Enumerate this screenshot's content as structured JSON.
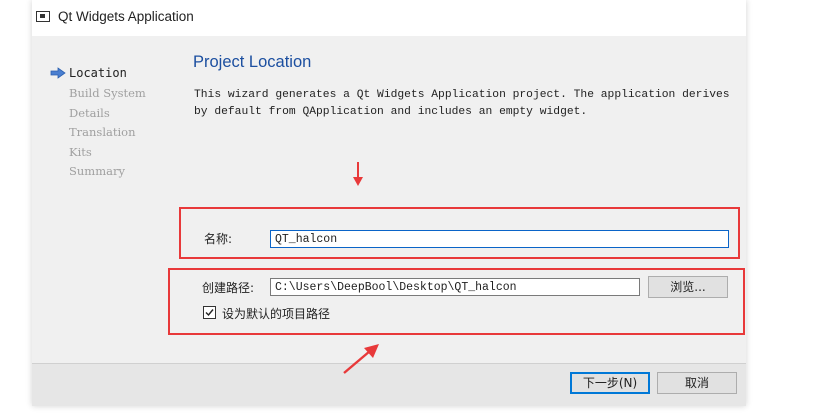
{
  "window": {
    "title": "Qt Widgets Application"
  },
  "sidebar": {
    "steps": [
      {
        "label": "Location",
        "active": true
      },
      {
        "label": "Build System",
        "active": false
      },
      {
        "label": "Details",
        "active": false
      },
      {
        "label": "Translation",
        "active": false
      },
      {
        "label": "Kits",
        "active": false
      },
      {
        "label": "Summary",
        "active": false
      }
    ]
  },
  "content": {
    "title": "Project Location",
    "description": "This wizard generates a Qt Widgets Application project. The application derives by default from QApplication and includes an empty widget."
  },
  "form": {
    "name_label": "名称:",
    "name_value": "QT_halcon",
    "path_label": "创建路径:",
    "path_value": "C:\\Users\\DeepBool\\Desktop\\QT_halcon",
    "browse_label": "浏览...",
    "default_path_label": "设为默认的项目路径",
    "default_path_checked": true
  },
  "footer": {
    "next_label": "下一步(N)",
    "cancel_label": "取消"
  },
  "colors": {
    "accent": "#1c4fa0",
    "annotation": "#e8393a",
    "focus": "#0a64c8"
  }
}
